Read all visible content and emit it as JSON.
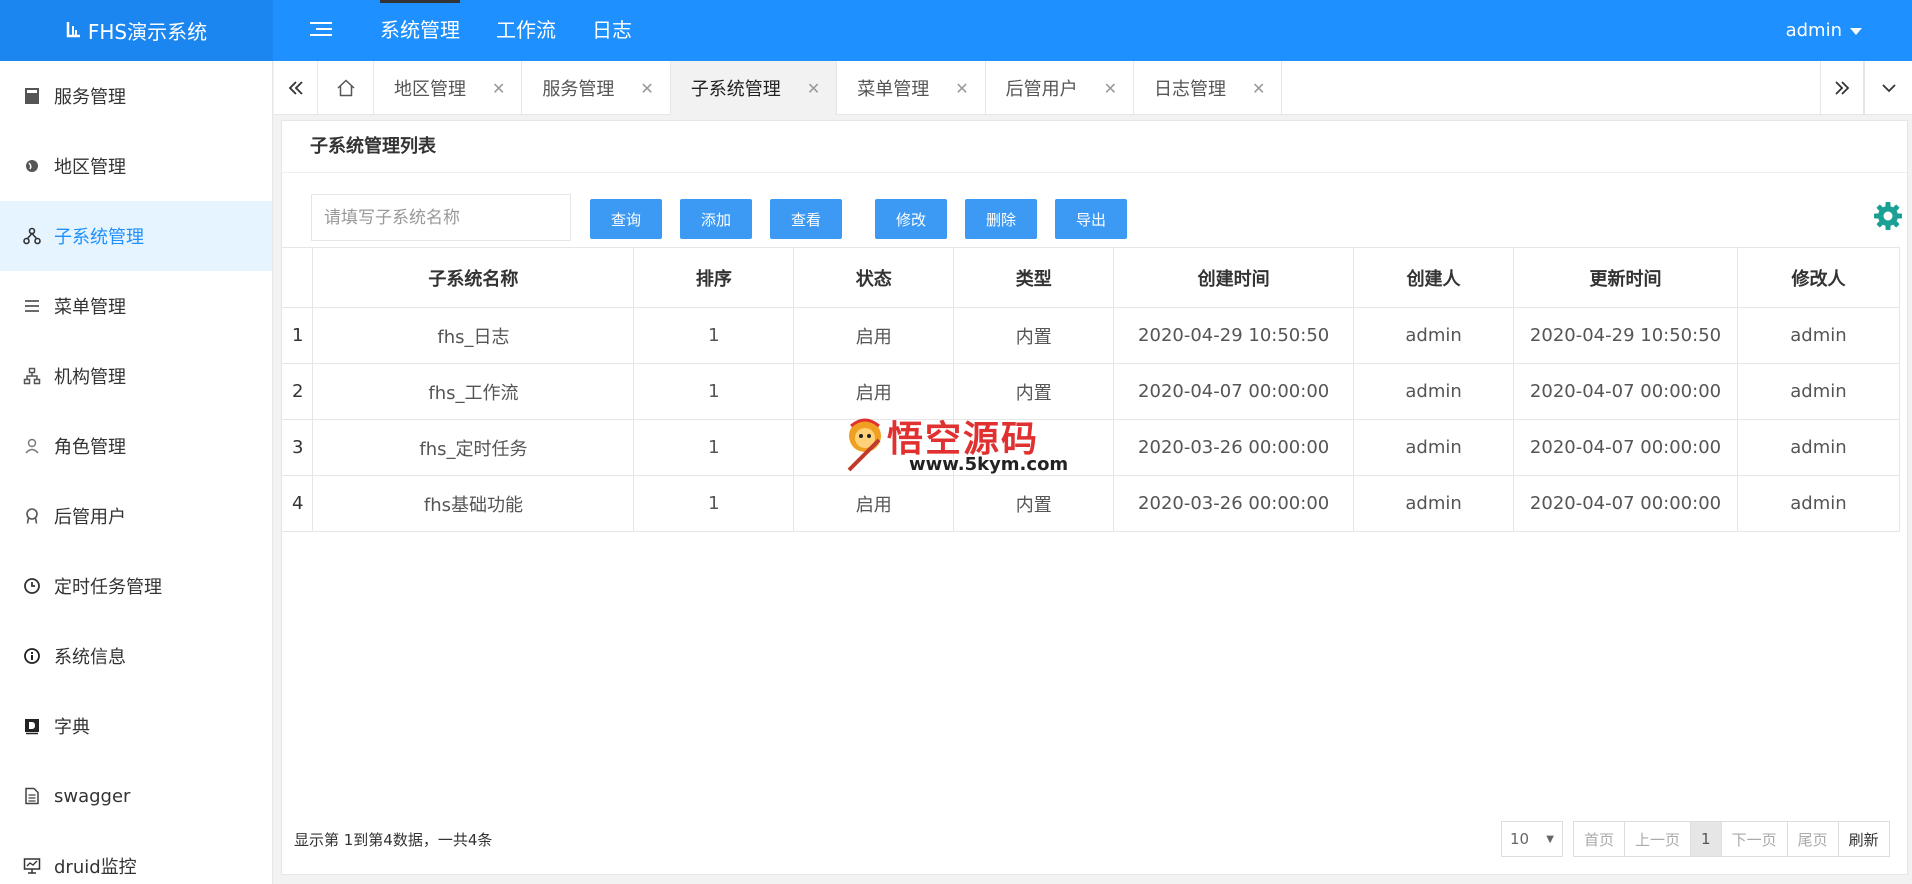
{
  "app": {
    "title": "FHS演示系统"
  },
  "topnav": [
    {
      "label": "系统管理",
      "active": true
    },
    {
      "label": "工作流"
    },
    {
      "label": "日志"
    }
  ],
  "user": {
    "name": "admin"
  },
  "sidebar": {
    "items": [
      {
        "label": "服务管理",
        "icon": "calculator-icon"
      },
      {
        "label": "地区管理",
        "icon": "globe-icon"
      },
      {
        "label": "子系统管理",
        "icon": "sitemap-icon",
        "active": true
      },
      {
        "label": "菜单管理",
        "icon": "list-icon"
      },
      {
        "label": "机构管理",
        "icon": "org-icon"
      },
      {
        "label": "角色管理",
        "icon": "user-icon"
      },
      {
        "label": "后管用户",
        "icon": "badge-icon"
      },
      {
        "label": "定时任务管理",
        "icon": "clock-icon"
      },
      {
        "label": "系统信息",
        "icon": "info-icon"
      },
      {
        "label": "字典",
        "icon": "dictionary-icon"
      },
      {
        "label": "swagger",
        "icon": "document-icon"
      },
      {
        "label": "druid监控",
        "icon": "monitor-icon"
      }
    ]
  },
  "tabs": [
    {
      "label": "地区管理"
    },
    {
      "label": "服务管理"
    },
    {
      "label": "子系统管理",
      "active": true
    },
    {
      "label": "菜单管理"
    },
    {
      "label": "后管用户"
    },
    {
      "label": "日志管理"
    }
  ],
  "panel": {
    "title": "子系统管理列表"
  },
  "search": {
    "placeholder": "请填写子系统名称",
    "value": ""
  },
  "buttons": {
    "query": "查询",
    "add": "添加",
    "view": "查看",
    "edit": "修改",
    "delete": "删除",
    "export": "导出"
  },
  "table": {
    "columns": [
      "子系统名称",
      "排序",
      "状态",
      "类型",
      "创建时间",
      "创建人",
      "更新时间",
      "修改人"
    ],
    "rows": [
      [
        "1",
        "fhs_日志",
        "1",
        "启用",
        "内置",
        "2020-04-29 10:50:50",
        "admin",
        "2020-04-29 10:50:50",
        "admin"
      ],
      [
        "2",
        "fhs_工作流",
        "1",
        "启用",
        "内置",
        "2020-04-07 00:00:00",
        "admin",
        "2020-04-07 00:00:00",
        "admin"
      ],
      [
        "3",
        "fhs_定时任务",
        "1",
        "",
        "",
        "2020-03-26 00:00:00",
        "admin",
        "2020-04-07 00:00:00",
        "admin"
      ],
      [
        "4",
        "fhs基础功能",
        "1",
        "启用",
        "内置",
        "2020-03-26 00:00:00",
        "admin",
        "2020-04-07 00:00:00",
        "admin"
      ]
    ]
  },
  "footer": {
    "info": "显示第 1到第4数据，一共4条"
  },
  "pager": {
    "page_size": "10",
    "first": "首页",
    "prev": "上一页",
    "current": "1",
    "next": "下一页",
    "last": "尾页",
    "refresh": "刷新"
  },
  "watermark": {
    "text": "悟空源码",
    "url": "www.5kym.com"
  },
  "colors": {
    "primary": "#1e90ff",
    "button": "#3c9af5",
    "gear": "#1aa094",
    "watermark": "#e03030"
  }
}
